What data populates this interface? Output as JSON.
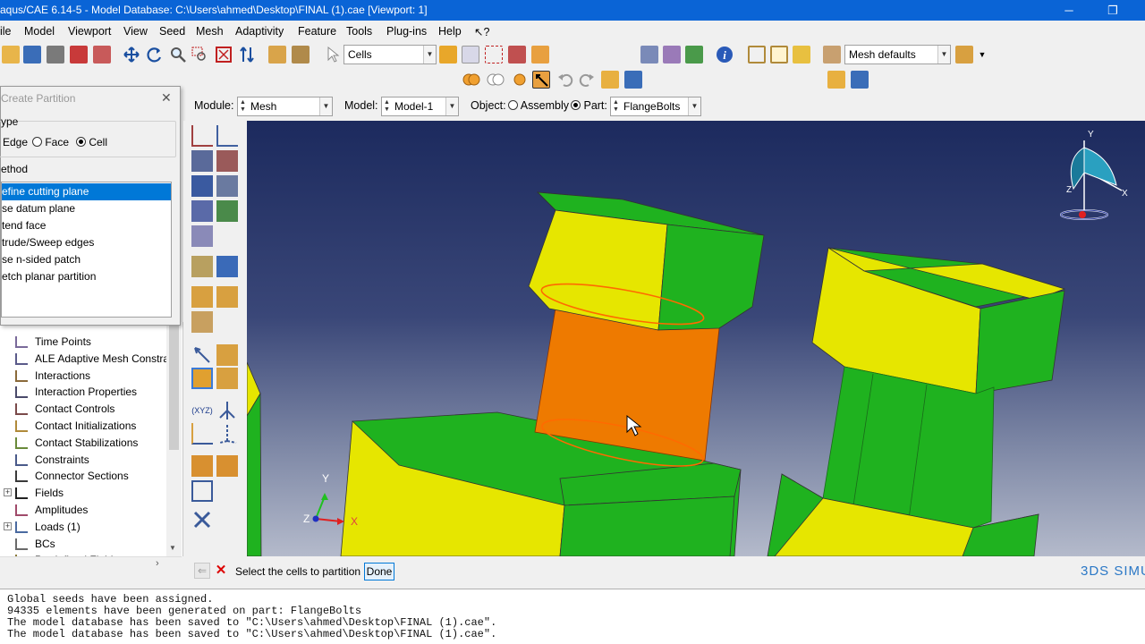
{
  "window": {
    "title": "aqus/CAE 6.14-5 - Model Database: C:\\Users\\ahmed\\Desktop\\FINAL (1).cae [Viewport: 1]",
    "minimize": "─",
    "restore": "❐"
  },
  "menu": {
    "items": [
      "ile",
      "Model",
      "Viewport",
      "View",
      "Seed",
      "Mesh",
      "Adaptivity",
      "Feature",
      "Tools",
      "Plug-ins",
      "Help",
      "↖?"
    ]
  },
  "toolbar": {
    "selection_filter": "Cells",
    "mesh_defaults": "Mesh defaults"
  },
  "context": {
    "module_label": "Module:",
    "module_value": "Mesh",
    "model_label": "Model:",
    "model_value": "Model-1",
    "object_label": "Object:",
    "assembly_label": "Assembly",
    "part_label": "Part:",
    "part_value": "FlangeBolts"
  },
  "dialog": {
    "title": "Create Partition",
    "close": "✕",
    "type_label": "ype",
    "type_options": [
      "Edge",
      "Face",
      "Cell"
    ],
    "type_selected": "Cell",
    "method_label": "ethod",
    "methods": [
      "efine cutting plane",
      "se datum plane",
      "tend face",
      "trude/Sweep edges",
      "se n-sided patch",
      "etch planar partition"
    ],
    "method_selected_index": 0
  },
  "tree": {
    "items": [
      {
        "label": "Time Points",
        "expander": ""
      },
      {
        "label": "ALE Adaptive Mesh Constrai",
        "expander": ""
      },
      {
        "label": "Interactions",
        "expander": ""
      },
      {
        "label": "Interaction Properties",
        "expander": ""
      },
      {
        "label": "Contact Controls",
        "expander": ""
      },
      {
        "label": "Contact Initializations",
        "expander": ""
      },
      {
        "label": "Contact Stabilizations",
        "expander": ""
      },
      {
        "label": "Constraints",
        "expander": ""
      },
      {
        "label": "Connector Sections",
        "expander": ""
      },
      {
        "label": "Fields",
        "expander": "+"
      },
      {
        "label": "Amplitudes",
        "expander": ""
      },
      {
        "label": "Loads (1)",
        "expander": "+"
      },
      {
        "label": "BCs",
        "expander": ""
      },
      {
        "label": "Predefined Fields",
        "expander": ""
      }
    ]
  },
  "prompt": {
    "text": "Select the cells to partition",
    "done": "Done",
    "back": "⇐",
    "cancel": "✕",
    "logo": "3DS SIMU"
  },
  "triad": {
    "x": "X",
    "y": "Y",
    "z": "Z"
  },
  "messages": [
    "Global seeds have been assigned.",
    "94335 elements have been generated on part: FlangeBolts",
    "The model database has been saved to \"C:\\Users\\ahmed\\Desktop\\FINAL (1).cae\".",
    "The model database has been saved to \"C:\\Users\\ahmed\\Desktop\\FINAL (1).cae\"."
  ],
  "colors": {
    "accent": "#0a64d6",
    "selection": "#0078d7",
    "bolt_yellow": "#e6e600",
    "bolt_green": "#1fb21f",
    "highlight_orange": "#ee7a00"
  }
}
